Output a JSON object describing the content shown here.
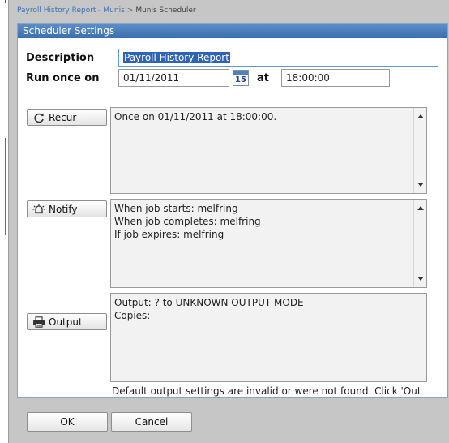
{
  "breadcrumb": {
    "items": [
      "Payroll History Report - Munis"
    ],
    "separator": ">",
    "current": "Munis Scheduler"
  },
  "dialog": {
    "title": "Scheduler Settings"
  },
  "form": {
    "description_label": "Description",
    "description_value": "Payroll History Report",
    "run_once_label": "Run once on",
    "run_date": "01/11/2011",
    "calendar_day": "15",
    "at_label": "at",
    "run_time": "18:00:00"
  },
  "recur": {
    "button_label": "Recur",
    "lines": [
      "Once on 01/11/2011 at 18:00:00."
    ]
  },
  "notify": {
    "button_label": "Notify",
    "lines": [
      "When job starts: melfring",
      "When job completes: melfring",
      "If job expires: melfring"
    ]
  },
  "output": {
    "button_label": "Output",
    "lines": [
      "Output:  ? to UNKNOWN OUTPUT MODE",
      "Copies:"
    ],
    "status_message": "Default output settings are invalid or were not found. Click 'Out"
  },
  "footer": {
    "ok_label": "OK",
    "cancel_label": "Cancel"
  },
  "colors": {
    "title_bar": "#3a6fae",
    "link": "#3d6fb6",
    "selection": "#2f63b8",
    "focus_border": "#5b9bd5"
  },
  "icons": {
    "recur": "refresh-icon",
    "notify": "alarm-icon",
    "output": "printer-icon",
    "calendar": "calendar-icon"
  }
}
